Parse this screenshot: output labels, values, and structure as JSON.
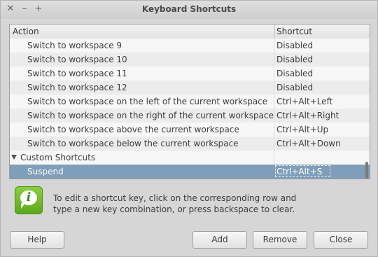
{
  "window": {
    "title": "Keyboard Shortcuts",
    "controls": {
      "close": "✕",
      "minimize": "–",
      "maximize": "+"
    }
  },
  "tree": {
    "columns": {
      "action": "Action",
      "shortcut": "Shortcut"
    },
    "rows": [
      {
        "action": "Switch to workspace 9",
        "shortcut": "Disabled"
      },
      {
        "action": "Switch to workspace 10",
        "shortcut": "Disabled"
      },
      {
        "action": "Switch to workspace 11",
        "shortcut": "Disabled"
      },
      {
        "action": "Switch to workspace 12",
        "shortcut": "Disabled"
      },
      {
        "action": "Switch to workspace on the left of the current workspace",
        "shortcut": "Ctrl+Alt+Left"
      },
      {
        "action": "Switch to workspace on the right of the current workspace",
        "shortcut": "Ctrl+Alt+Right"
      },
      {
        "action": "Switch to workspace above the current workspace",
        "shortcut": "Ctrl+Alt+Up"
      },
      {
        "action": "Switch to workspace below the current workspace",
        "shortcut": "Ctrl+Alt+Down"
      },
      {
        "action": "Custom Shortcuts",
        "shortcut": "",
        "group": true,
        "expanded": true
      },
      {
        "action": "Suspend",
        "shortcut": "Ctrl+Alt+S",
        "selected": true
      }
    ]
  },
  "info": {
    "icon": "info-bubble-icon",
    "glyph": "i",
    "line1": "To edit a shortcut key, click on the corresponding row and",
    "line2": "type a new key combination, or press backspace to clear."
  },
  "buttons": {
    "help": "Help",
    "add": "Add",
    "remove": "Remove",
    "close": "Close"
  },
  "colors": {
    "selection": "#7e9eb9",
    "info_green": "#6bb82a",
    "background": "#d6d6d6"
  }
}
